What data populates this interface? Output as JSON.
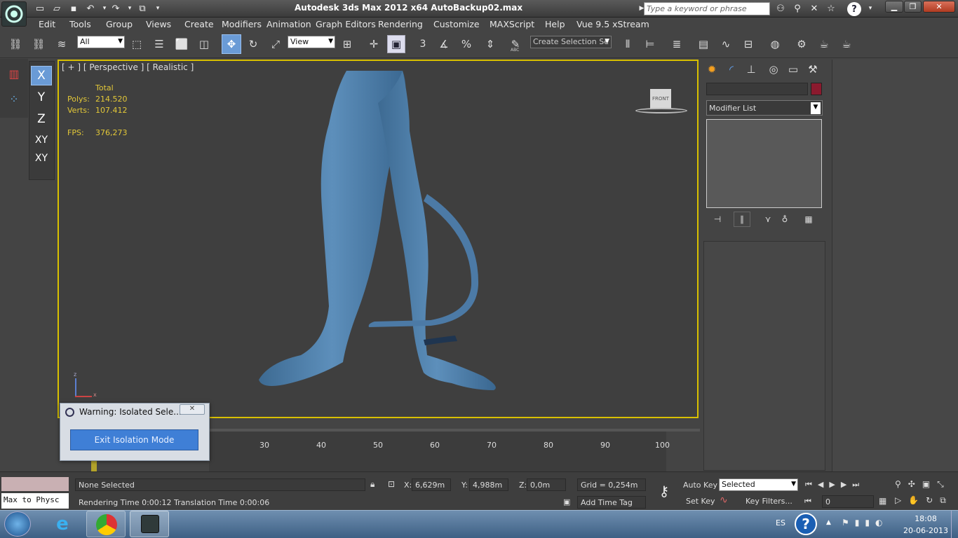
{
  "app": {
    "title": "Autodesk 3ds Max  2012 x64     AutoBackup02.max",
    "search_placeholder": "Type a keyword or phrase",
    "help_glyph": "?"
  },
  "menus": [
    "Edit",
    "Tools",
    "Group",
    "Views",
    "Create",
    "Modifiers",
    "Animation",
    "Graph Editors",
    "Rendering",
    "Customize",
    "MAXScript",
    "Help",
    "Vue 9.5 xStream"
  ],
  "toolbar": {
    "selection_filter": "All",
    "ref_coord": "View",
    "named_selection": "Create Selection Se",
    "snap_3": "3",
    "abc_label": "ABC"
  },
  "axis_constraints": [
    "X",
    "Y",
    "Z",
    "XY",
    "XY"
  ],
  "viewport": {
    "label": "[ + ] [ Perspective ] [ Realistic ]",
    "stats_header": "Total",
    "polys_label": "Polys:",
    "polys_value": "214.520",
    "verts_label": "Verts:",
    "verts_value": "107.412",
    "fps_label": "FPS:",
    "fps_value": "376,273",
    "viewcube_label": "FRONT",
    "gizmo_z": "z",
    "gizmo_x": "x"
  },
  "command_panel": {
    "modifier_list": "Modifier List",
    "color_swatch": "#8b1a2e"
  },
  "dialog": {
    "title": "Warning: Isolated Sele...",
    "button": "Exit Isolation Mode"
  },
  "timeline": {
    "ticks": [
      "30",
      "40",
      "50",
      "60",
      "70",
      "80",
      "90",
      "100"
    ]
  },
  "status": {
    "maxscript_text": "Max to Physc",
    "selection_text": "None Selected",
    "prompt_text": "Rendering Time  0:00:12    Translation Time  0:00:06",
    "x_label": "X:",
    "x_value": "6,629m",
    "y_label": "Y:",
    "y_value": "4,988m",
    "z_label": "Z:",
    "z_value": "0,0m",
    "grid": "Grid = 0,254m",
    "add_time_tag": "Add Time Tag",
    "auto_key": "Auto Key",
    "set_key": "Set Key",
    "key_mode": "Selected",
    "key_filters": "Key Filters...",
    "frame_value": "0"
  },
  "taskbar": {
    "language": "ES",
    "time": "18:08",
    "date": "20-06-2013"
  }
}
